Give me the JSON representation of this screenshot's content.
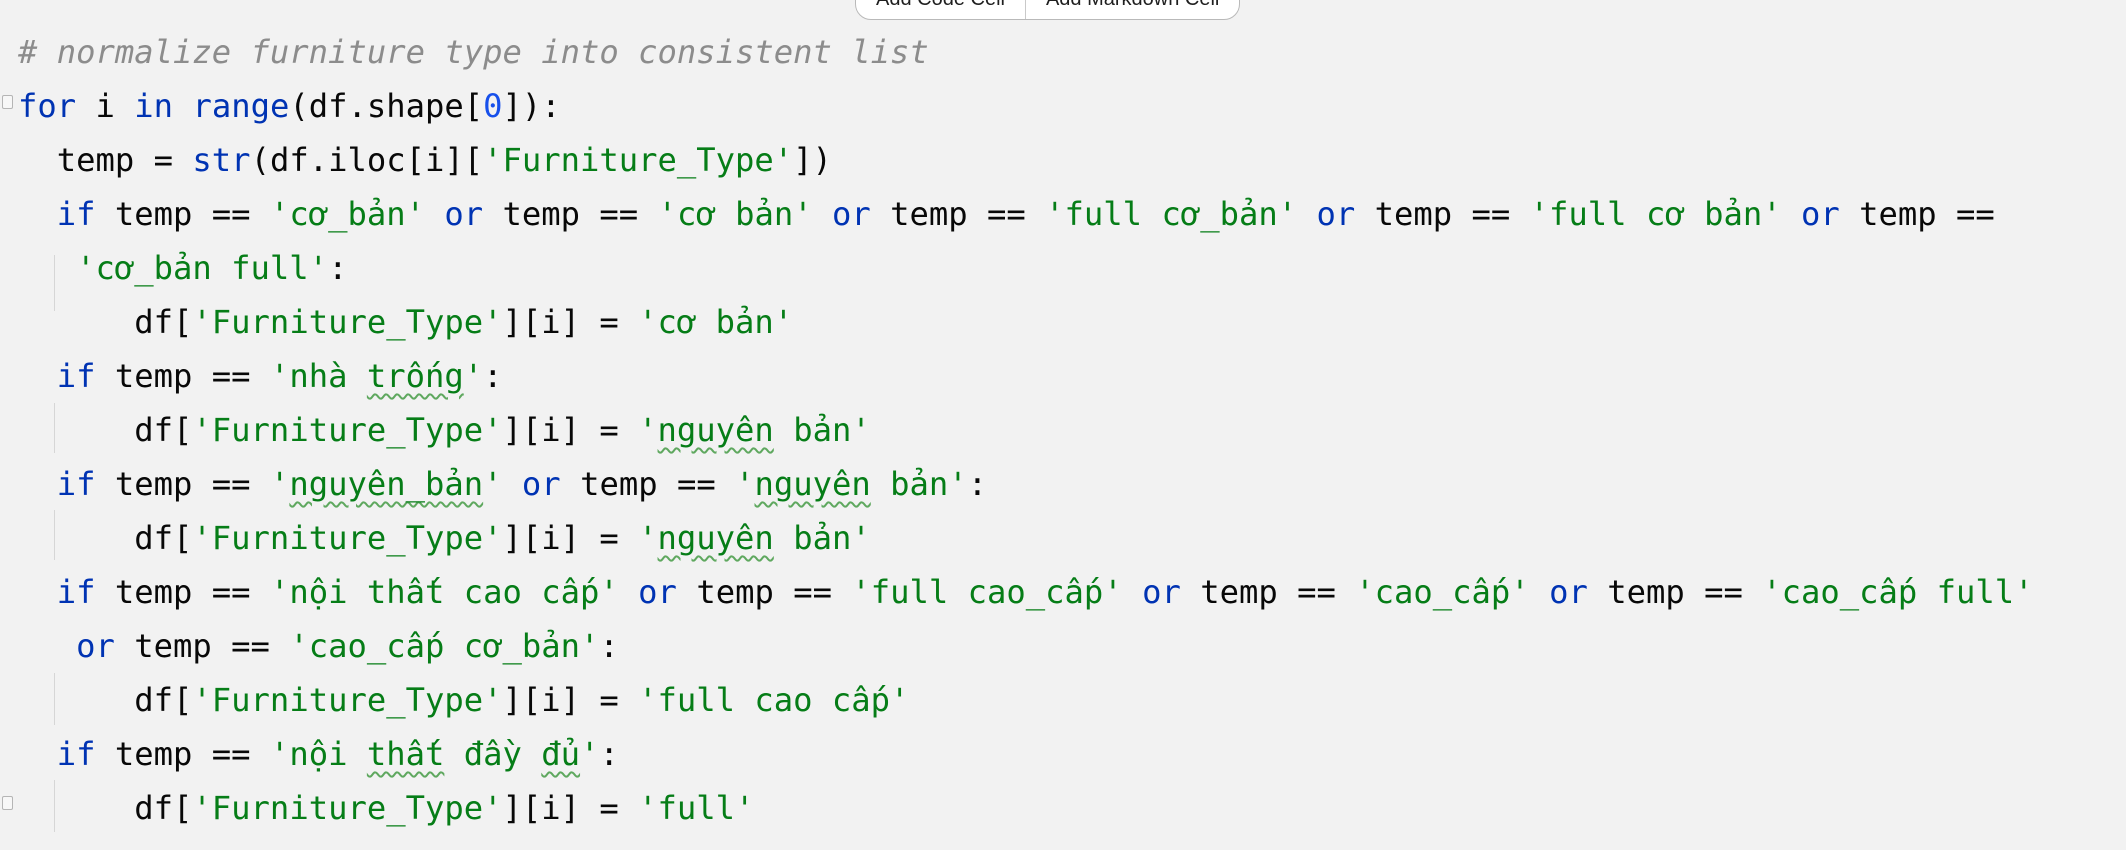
{
  "toolbar": {
    "add_code_cell": "Add Code Cell",
    "add_markdown_cell": "Add Markdown Cell"
  },
  "icons": {
    "fold_start": "fold-start-icon",
    "fold_end": "fold-end-icon"
  },
  "colors": {
    "background": "#f2f2f2",
    "keyword": "#0033b3",
    "string": "#067d17",
    "number": "#1750eb",
    "comment": "#8c8c8c",
    "default_text": "#080808"
  },
  "code": {
    "comment": "# normalize furniture type into consistent list",
    "line2": {
      "for": "for",
      "i": " i ",
      "in": "in",
      "sp": " ",
      "range": "range",
      "rest1": "(df.shape[",
      "zero": "0",
      "rest2": "]):"
    },
    "line3": {
      "a": "  temp = ",
      "str": "str",
      "b": "(df.iloc[i][",
      "s1": "'Furniture_Type'",
      "c": "])"
    },
    "line4": {
      "if": "if",
      "a": " temp == ",
      "s1": "'cơ_bản'",
      "or1": "or",
      "b": " temp == ",
      "s2": "'cơ bản'",
      "or2": "or",
      "c": " temp == ",
      "s3": "'full cơ_bản'",
      "or3": "or",
      "d": " temp == ",
      "s4": "'full cơ bản'",
      "or4": "or",
      "e": " temp =="
    },
    "line5": {
      "s1": "'cơ_bản full'",
      "a": ":"
    },
    "line6": {
      "a": "df[",
      "s1": "'Furniture_Type'",
      "b": "][i] = ",
      "s2": "'cơ bản'"
    },
    "line7": {
      "if": "if",
      "a": " temp == ",
      "s1a": "'nhà ",
      "s1b": "trống",
      "s1c": "'",
      "b": ":"
    },
    "line8": {
      "a": "df[",
      "s1": "'Furniture_Type'",
      "b": "][i] = ",
      "s2a": "'",
      "s2b": "nguyên",
      "s2c": " bản'"
    },
    "line9": {
      "if": "if",
      "a": " temp == ",
      "s1a": "'",
      "s1b": "nguyên_bản",
      "s1c": "'",
      "or1": "or",
      "b": " temp == ",
      "s2a": "'",
      "s2b": "nguyên",
      "s2c": " bản'",
      "c": ":"
    },
    "line10": {
      "a": "df[",
      "s1": "'Furniture_Type'",
      "b": "][i] = ",
      "s2a": "'",
      "s2b": "nguyên",
      "s2c": " bản'"
    },
    "line11": {
      "if": "if",
      "a": " temp == ",
      "s1": "'nội thất cao cấp'",
      "or1": "or",
      "b": " temp == ",
      "s2": "'full cao_cấp'",
      "or2": "or",
      "c": " temp == ",
      "s3": "'cao_cấp'",
      "or3": "or",
      "d": " temp == ",
      "s4": "'cao_cấp full'"
    },
    "line12": {
      "or": "or",
      "a": " temp == ",
      "s1": "'cao_cấp cơ_bản'",
      "b": ":"
    },
    "line13": {
      "a": "df[",
      "s1": "'Furniture_Type'",
      "b": "][i] = ",
      "s2": "'full cao cấp'"
    },
    "line14": {
      "if": "if",
      "a": " temp == ",
      "s1a": "'nội ",
      "s1b": "thất",
      "s1c": " đầy ",
      "s1d": "đủ",
      "s1e": "'",
      "b": ":"
    },
    "line15": {
      "a": "df[",
      "s1": "'Furniture_Type'",
      "b": "][i] = ",
      "s2": "'full'"
    }
  }
}
